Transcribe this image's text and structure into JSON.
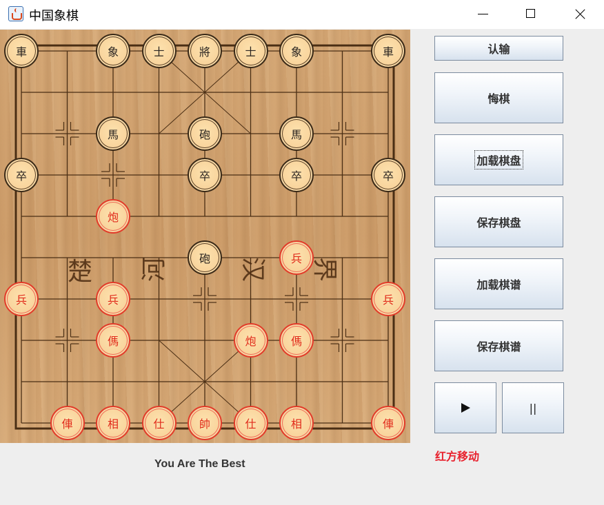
{
  "window": {
    "title": "中国象棋",
    "icon": "java-cup-icon",
    "controls": {
      "minimize": "minimize-icon",
      "maximize": "maximize-icon",
      "close": "close-icon"
    }
  },
  "board": {
    "river_text": [
      "楚",
      "河",
      "汉",
      "界"
    ],
    "pieces": [
      {
        "side": "black",
        "text": "車",
        "file": 0,
        "rank": 0
      },
      {
        "side": "black",
        "text": "象",
        "file": 2,
        "rank": 0
      },
      {
        "side": "black",
        "text": "士",
        "file": 3,
        "rank": 0
      },
      {
        "side": "black",
        "text": "將",
        "file": 4,
        "rank": 0
      },
      {
        "side": "black",
        "text": "士",
        "file": 5,
        "rank": 0
      },
      {
        "side": "black",
        "text": "象",
        "file": 6,
        "rank": 0
      },
      {
        "side": "black",
        "text": "車",
        "file": 8,
        "rank": 0
      },
      {
        "side": "black",
        "text": "馬",
        "file": 2,
        "rank": 2
      },
      {
        "side": "black",
        "text": "砲",
        "file": 4,
        "rank": 2
      },
      {
        "side": "black",
        "text": "馬",
        "file": 6,
        "rank": 2
      },
      {
        "side": "black",
        "text": "卒",
        "file": 0,
        "rank": 3
      },
      {
        "side": "black",
        "text": "卒",
        "file": 4,
        "rank": 3
      },
      {
        "side": "black",
        "text": "卒",
        "file": 6,
        "rank": 3
      },
      {
        "side": "black",
        "text": "卒",
        "file": 8,
        "rank": 3
      },
      {
        "side": "black",
        "text": "砲",
        "file": 4,
        "rank": 5
      },
      {
        "side": "red",
        "text": "炮",
        "file": 2,
        "rank": 4
      },
      {
        "side": "red",
        "text": "兵",
        "file": 6,
        "rank": 5
      },
      {
        "side": "red",
        "text": "兵",
        "file": 0,
        "rank": 6
      },
      {
        "side": "red",
        "text": "兵",
        "file": 2,
        "rank": 6
      },
      {
        "side": "red",
        "text": "兵",
        "file": 8,
        "rank": 6
      },
      {
        "side": "red",
        "text": "傌",
        "file": 2,
        "rank": 7
      },
      {
        "side": "red",
        "text": "炮",
        "file": 5,
        "rank": 7
      },
      {
        "side": "red",
        "text": "傌",
        "file": 6,
        "rank": 7
      },
      {
        "side": "red",
        "text": "俥",
        "file": 1,
        "rank": 9
      },
      {
        "side": "red",
        "text": "相",
        "file": 2,
        "rank": 9
      },
      {
        "side": "red",
        "text": "仕",
        "file": 3,
        "rank": 9
      },
      {
        "side": "red",
        "text": "帥",
        "file": 4,
        "rank": 9
      },
      {
        "side": "red",
        "text": "仕",
        "file": 5,
        "rank": 9
      },
      {
        "side": "red",
        "text": "相",
        "file": 6,
        "rank": 9
      },
      {
        "side": "red",
        "text": "俥",
        "file": 8,
        "rank": 9
      }
    ]
  },
  "sidebar": {
    "buttons": [
      "认输",
      "悔棋",
      "加载棋盘",
      "保存棋盘",
      "加载棋谱",
      "保存棋谱"
    ],
    "play_icon": "play-icon",
    "pause_label": "||",
    "status": "红方移动"
  },
  "footer": {
    "text": "You Are The Best"
  },
  "colors": {
    "red_piece": "#e02a1a",
    "black_piece": "#2a2420",
    "status": "#e8222e"
  }
}
